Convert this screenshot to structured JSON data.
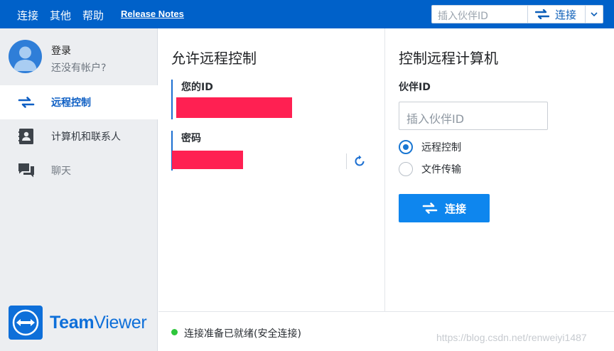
{
  "menu": {
    "connect": "连接",
    "other": "其他",
    "help": "帮助",
    "release_notes": "Release Notes"
  },
  "top_search": {
    "placeholder": "插入伙伴ID",
    "connect_label": "连接"
  },
  "sidebar": {
    "login": "登录",
    "no_account": "还没有帐户?",
    "items": [
      {
        "label": "远程控制",
        "icon": "arrows-swap-icon",
        "active": true
      },
      {
        "label": "计算机和联系人",
        "icon": "contacts-icon",
        "active": false
      },
      {
        "label": "聊天",
        "icon": "chat-icon",
        "active": false
      }
    ],
    "logo_bold": "Team",
    "logo_light": "Viewer"
  },
  "allow_panel": {
    "title": "允许远程控制",
    "your_id_label": "您的ID",
    "password_label": "密码"
  },
  "control_panel": {
    "title": "控制远程计算机",
    "partner_id_label": "伙伴ID",
    "partner_placeholder": "插入伙伴ID",
    "options": [
      {
        "label": "远程控制",
        "checked": true
      },
      {
        "label": "文件传输",
        "checked": false
      }
    ],
    "connect_button": "连接"
  },
  "status": {
    "text": "连接准备已就绪(安全连接)",
    "color": "#2ec63b"
  },
  "watermark": "https://blog.csdn.net/renweiyi1487",
  "colors": {
    "brand_blue": "#0061c9",
    "accent": "#0e86ee",
    "redaction": "#ff2052"
  }
}
